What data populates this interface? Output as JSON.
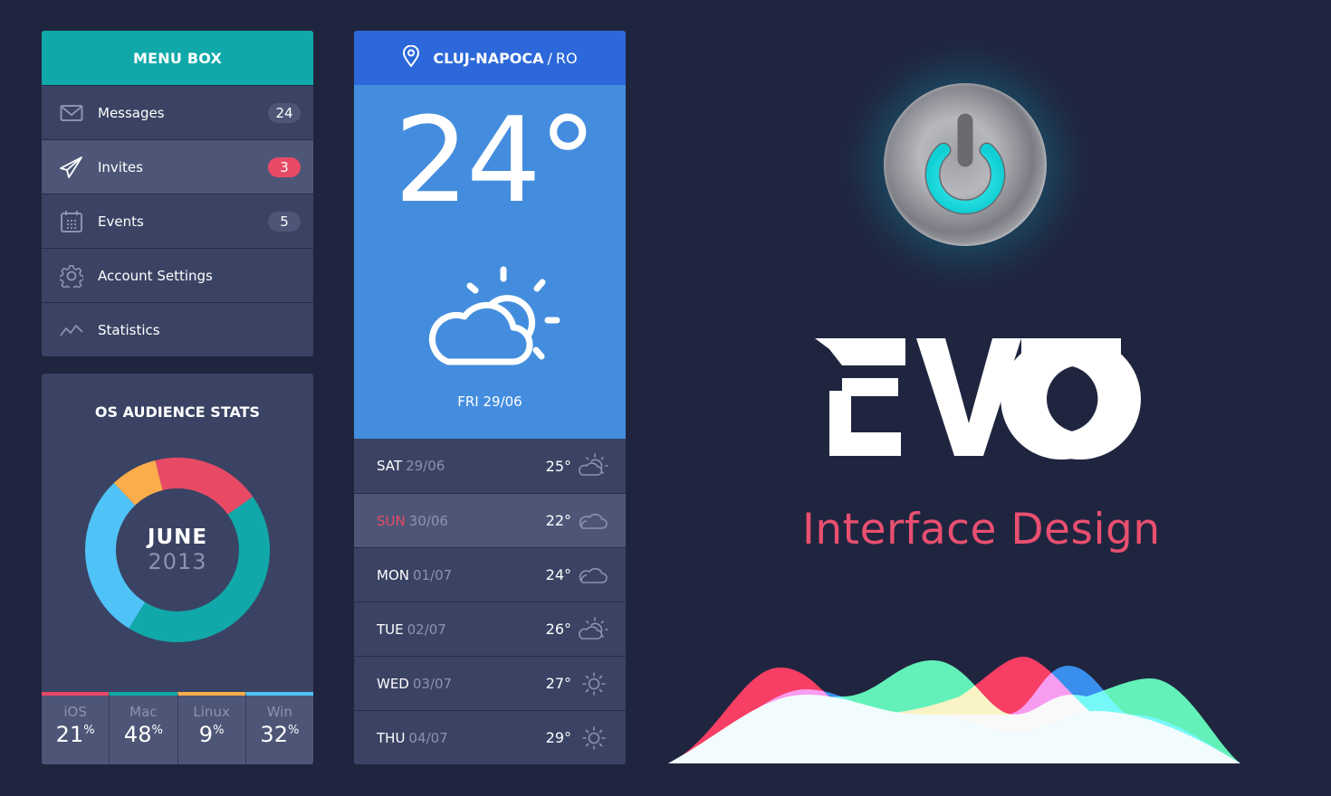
{
  "menu": {
    "title": "MENU BOX",
    "items": [
      {
        "label": "Messages",
        "icon": "envelope-icon",
        "badge": "24",
        "badge_color": "#4d5677",
        "active": false
      },
      {
        "label": "Invites",
        "icon": "paper-plane-icon",
        "badge": "3",
        "badge_color": "#e84a66",
        "active": true
      },
      {
        "label": "Events",
        "icon": "calendar-icon",
        "badge": "5",
        "badge_color": "#4d5677",
        "active": false
      },
      {
        "label": "Account Settings",
        "icon": "gear-icon",
        "badge": null,
        "active": false
      },
      {
        "label": "Statistics",
        "icon": "line-chart-icon",
        "badge": null,
        "active": false
      }
    ]
  },
  "stats": {
    "title": "OS AUDIENCE STATS",
    "center_month": "JUNE",
    "center_year": "2013",
    "legend": [
      {
        "name": "iOS",
        "value": "21",
        "unit": "%",
        "color": "#e84a66"
      },
      {
        "name": "Mac",
        "value": "48",
        "unit": "%",
        "color": "#11a8a9"
      },
      {
        "name": "Linux",
        "value": "9",
        "unit": "%",
        "color": "#fbad4b"
      },
      {
        "name": "Win",
        "value": "32",
        "unit": "%",
        "color": "#4fc3f7"
      }
    ]
  },
  "chart_data": {
    "type": "pie",
    "title": "OS AUDIENCE STATS",
    "subtitle": "JUNE 2013",
    "categories": [
      "iOS",
      "Mac",
      "Win",
      "Linux"
    ],
    "values": [
      21,
      48,
      32,
      9
    ],
    "colors": [
      "#e84a66",
      "#11a8a9",
      "#4fc3f7",
      "#fbad4b"
    ],
    "donut": true
  },
  "weather": {
    "city": "CLUJ-NAPOCA",
    "separator": "/",
    "country": "RO",
    "current_temp": "24°",
    "current_icon": "partly-cloudy-icon",
    "current_date": "FRI  29/06",
    "forecast": [
      {
        "day": "SAT",
        "date": "29/06",
        "temp": "25°",
        "icon": "partly-cloudy-icon",
        "highlight": false
      },
      {
        "day": "SUN",
        "date": "30/06",
        "temp": "22°",
        "icon": "cloudy-icon",
        "highlight": true
      },
      {
        "day": "MON",
        "date": "01/07",
        "temp": "24°",
        "icon": "cloudy-icon",
        "highlight": false
      },
      {
        "day": "TUE",
        "date": "02/07",
        "temp": "26°",
        "icon": "partly-cloudy-icon",
        "highlight": false
      },
      {
        "day": "WED",
        "date": "03/07",
        "temp": "27°",
        "icon": "sun-icon",
        "highlight": false
      },
      {
        "day": "THU",
        "date": "04/07",
        "temp": "29°",
        "icon": "sun-icon",
        "highlight": false
      }
    ]
  },
  "brand": {
    "logo": "EVO",
    "tagline": "Interface Design",
    "accent": "#e84f70"
  }
}
